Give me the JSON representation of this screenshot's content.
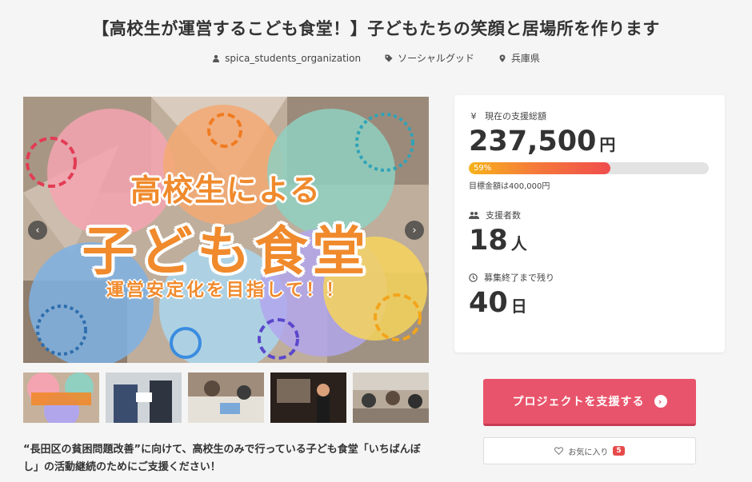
{
  "page": {
    "title": "【高校生が運営するこども食堂！】子どもたちの笑顔と居場所を作ります"
  },
  "meta": {
    "owner": "spica_students_organization",
    "category": "ソーシャルグッド",
    "location": "兵庫県"
  },
  "hero": {
    "line1": "高校生による",
    "line2": "子ども食堂",
    "line3": "運営安定化を目指して！！",
    "prev_icon": "chevron-left-icon",
    "next_icon": "chevron-right-icon"
  },
  "thumbnails": [
    {
      "label": "高校生による子ども食堂"
    },
    {
      "label": ""
    },
    {
      "label": ""
    },
    {
      "label": ""
    },
    {
      "label": ""
    }
  ],
  "description": "“長田区の貧困問題改善”に向けて、高校生のみで行っている子ども食堂「いちばんぼし」の活動継続のためにご支援ください！",
  "stats": {
    "total_label": "現在の支援総額",
    "total_value": "237,500",
    "total_unit": "円",
    "progress_percent": 59,
    "progress_text": "59%",
    "goal_text": "目標金額は400,000円",
    "backers_label": "支援者数",
    "backers_value": "18",
    "backers_unit": "人",
    "remaining_label": "募集終了まで残り",
    "remaining_value": "40",
    "remaining_unit": "日"
  },
  "actions": {
    "support_label": "プロジェクトを支援する",
    "favorite_label": "お気に入り",
    "favorite_count": "5"
  },
  "colors": {
    "accent": "#e8546b",
    "hero_text": "#f08a2c",
    "badge": "#e84a4a"
  }
}
